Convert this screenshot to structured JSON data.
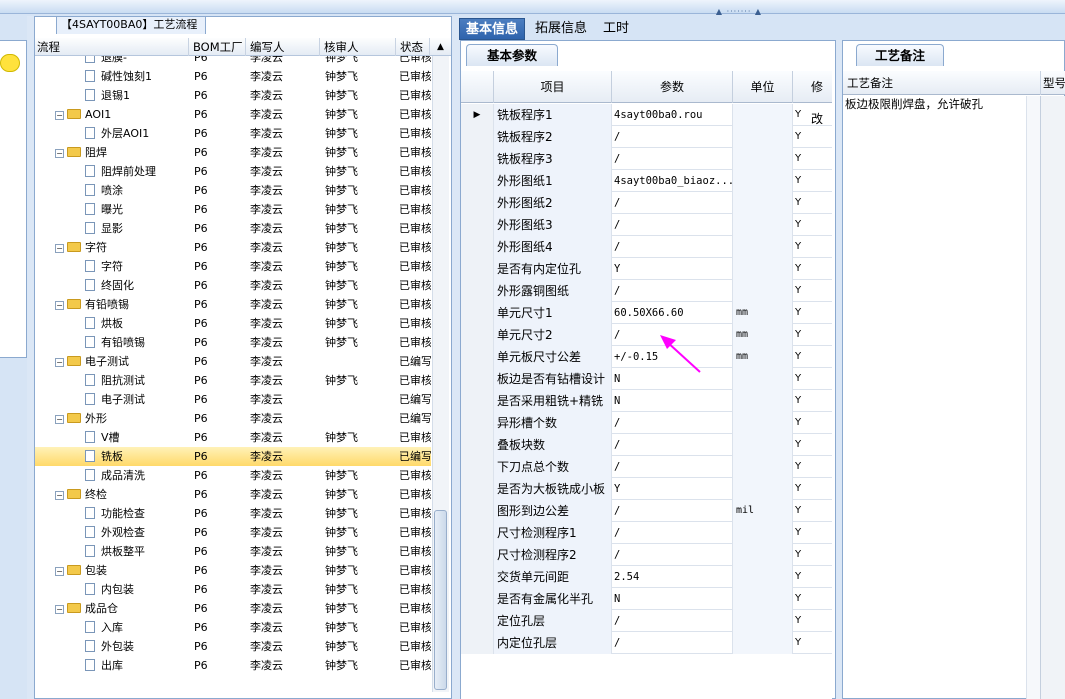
{
  "tree_panel": {
    "title": "【4SAYT00BA0】工艺流程",
    "columns": [
      "流程",
      "BOM工厂",
      "编写人",
      "核审人",
      "状态"
    ],
    "rows": [
      {
        "kind": "leaf",
        "name": "退膜-",
        "bom": "P6",
        "writer": "李凌云",
        "reviewer": "钟梦飞",
        "status": "已审核"
      },
      {
        "kind": "leaf",
        "name": "碱性蚀刻1",
        "bom": "P6",
        "writer": "李凌云",
        "reviewer": "钟梦飞",
        "status": "已审核"
      },
      {
        "kind": "leaf",
        "name": "退锡1",
        "bom": "P6",
        "writer": "李凌云",
        "reviewer": "钟梦飞",
        "status": "已审核"
      },
      {
        "kind": "folder",
        "name": "AOI1",
        "bom": "P6",
        "writer": "李凌云",
        "reviewer": "钟梦飞",
        "status": "已审核"
      },
      {
        "kind": "leaf",
        "name": "外层AOI1",
        "bom": "P6",
        "writer": "李凌云",
        "reviewer": "钟梦飞",
        "status": "已审核"
      },
      {
        "kind": "folder",
        "name": "阻焊",
        "bom": "P6",
        "writer": "李凌云",
        "reviewer": "钟梦飞",
        "status": "已审核"
      },
      {
        "kind": "leaf",
        "name": "阻焊前处理",
        "bom": "P6",
        "writer": "李凌云",
        "reviewer": "钟梦飞",
        "status": "已审核"
      },
      {
        "kind": "leaf",
        "name": "喷涂",
        "bom": "P6",
        "writer": "李凌云",
        "reviewer": "钟梦飞",
        "status": "已审核"
      },
      {
        "kind": "leaf",
        "name": "曝光",
        "bom": "P6",
        "writer": "李凌云",
        "reviewer": "钟梦飞",
        "status": "已审核"
      },
      {
        "kind": "leaf",
        "name": "显影",
        "bom": "P6",
        "writer": "李凌云",
        "reviewer": "钟梦飞",
        "status": "已审核"
      },
      {
        "kind": "folder",
        "name": "字符",
        "bom": "P6",
        "writer": "李凌云",
        "reviewer": "钟梦飞",
        "status": "已审核"
      },
      {
        "kind": "leaf",
        "name": "字符",
        "bom": "P6",
        "writer": "李凌云",
        "reviewer": "钟梦飞",
        "status": "已审核"
      },
      {
        "kind": "leaf",
        "name": "终固化",
        "bom": "P6",
        "writer": "李凌云",
        "reviewer": "钟梦飞",
        "status": "已审核"
      },
      {
        "kind": "folder",
        "name": "有铅喷锡",
        "bom": "P6",
        "writer": "李凌云",
        "reviewer": "钟梦飞",
        "status": "已审核"
      },
      {
        "kind": "leaf",
        "name": "烘板",
        "bom": "P6",
        "writer": "李凌云",
        "reviewer": "钟梦飞",
        "status": "已审核"
      },
      {
        "kind": "leaf",
        "name": "有铅喷锡",
        "bom": "P6",
        "writer": "李凌云",
        "reviewer": "钟梦飞",
        "status": "已审核"
      },
      {
        "kind": "folder",
        "name": "电子测试",
        "bom": "P6",
        "writer": "李凌云",
        "reviewer": "",
        "status": "已编写"
      },
      {
        "kind": "leaf",
        "name": "阻抗测试",
        "bom": "P6",
        "writer": "李凌云",
        "reviewer": "钟梦飞",
        "status": "已审核"
      },
      {
        "kind": "leaf",
        "name": "电子测试",
        "bom": "P6",
        "writer": "李凌云",
        "reviewer": "",
        "status": "已编写"
      },
      {
        "kind": "folder",
        "name": "外形",
        "bom": "P6",
        "writer": "李凌云",
        "reviewer": "",
        "status": "已编写"
      },
      {
        "kind": "leaf",
        "name": "V槽",
        "bom": "P6",
        "writer": "李凌云",
        "reviewer": "钟梦飞",
        "status": "已审核"
      },
      {
        "kind": "leaf",
        "name": "铣板",
        "bom": "P6",
        "writer": "李凌云",
        "reviewer": "",
        "status": "已编写",
        "selected": true
      },
      {
        "kind": "leaf",
        "name": "成品清洗",
        "bom": "P6",
        "writer": "李凌云",
        "reviewer": "钟梦飞",
        "status": "已审核"
      },
      {
        "kind": "folder",
        "name": "终检",
        "bom": "P6",
        "writer": "李凌云",
        "reviewer": "钟梦飞",
        "status": "已审核"
      },
      {
        "kind": "leaf",
        "name": "功能检查",
        "bom": "P6",
        "writer": "李凌云",
        "reviewer": "钟梦飞",
        "status": "已审核"
      },
      {
        "kind": "leaf",
        "name": "外观检查",
        "bom": "P6",
        "writer": "李凌云",
        "reviewer": "钟梦飞",
        "status": "已审核"
      },
      {
        "kind": "leaf",
        "name": "烘板整平",
        "bom": "P6",
        "writer": "李凌云",
        "reviewer": "钟梦飞",
        "status": "已审核"
      },
      {
        "kind": "folder",
        "name": "包装",
        "bom": "P6",
        "writer": "李凌云",
        "reviewer": "钟梦飞",
        "status": "已审核"
      },
      {
        "kind": "leaf",
        "name": "内包装",
        "bom": "P6",
        "writer": "李凌云",
        "reviewer": "钟梦飞",
        "status": "已审核"
      },
      {
        "kind": "folder",
        "name": "成品仓",
        "bom": "P6",
        "writer": "李凌云",
        "reviewer": "钟梦飞",
        "status": "已审核"
      },
      {
        "kind": "leaf",
        "name": "入库",
        "bom": "P6",
        "writer": "李凌云",
        "reviewer": "钟梦飞",
        "status": "已审核"
      },
      {
        "kind": "leaf",
        "name": "外包装",
        "bom": "P6",
        "writer": "李凌云",
        "reviewer": "钟梦飞",
        "status": "已审核"
      },
      {
        "kind": "leaf",
        "name": "出库",
        "bom": "P6",
        "writer": "李凌云",
        "reviewer": "钟梦飞",
        "status": "已审核"
      }
    ]
  },
  "main_tabs": [
    "基本信息",
    "拓展信息",
    "工时"
  ],
  "subtab": "基本参数",
  "grid": {
    "columns": [
      "项目",
      "参数",
      "单位",
      "修改"
    ],
    "rows": [
      {
        "item": "铣板程序1",
        "value": "4sayt00ba0.rou",
        "unit": "",
        "mod": "Y",
        "current": true
      },
      {
        "item": "铣板程序2",
        "value": "/",
        "unit": "",
        "mod": "Y"
      },
      {
        "item": "铣板程序3",
        "value": "/",
        "unit": "",
        "mod": "Y"
      },
      {
        "item": "外形图纸1",
        "value": "4sayt00ba0_biaoz...",
        "unit": "",
        "mod": "Y"
      },
      {
        "item": "外形图纸2",
        "value": "/",
        "unit": "",
        "mod": "Y"
      },
      {
        "item": "外形图纸3",
        "value": "/",
        "unit": "",
        "mod": "Y"
      },
      {
        "item": "外形图纸4",
        "value": "/",
        "unit": "",
        "mod": "Y"
      },
      {
        "item": "是否有内定位孔",
        "value": "Y",
        "unit": "",
        "mod": "Y"
      },
      {
        "item": "外形露铜图纸",
        "value": "/",
        "unit": "",
        "mod": "Y"
      },
      {
        "item": "单元尺寸1",
        "value": "60.50X66.60",
        "unit": "mm",
        "mod": "Y"
      },
      {
        "item": "单元尺寸2",
        "value": "/",
        "unit": "mm",
        "mod": "Y"
      },
      {
        "item": "单元板尺寸公差",
        "value": "+/-0.15",
        "unit": "mm",
        "mod": "Y"
      },
      {
        "item": "板边是否有钻槽设计",
        "value": "N",
        "unit": "",
        "mod": "Y"
      },
      {
        "item": "是否采用粗铣+精铣",
        "value": "N",
        "unit": "",
        "mod": "Y"
      },
      {
        "item": "异形槽个数",
        "value": "/",
        "unit": "",
        "mod": "Y"
      },
      {
        "item": "叠板块数",
        "value": "/",
        "unit": "",
        "mod": "Y"
      },
      {
        "item": "下刀点总个数",
        "value": "/",
        "unit": "",
        "mod": "Y"
      },
      {
        "item": "是否为大板铣成小板",
        "value": "Y",
        "unit": "",
        "mod": "Y"
      },
      {
        "item": "图形到边公差",
        "value": "/",
        "unit": "mil",
        "mod": "Y"
      },
      {
        "item": "尺寸检测程序1",
        "value": "/",
        "unit": "",
        "mod": "Y"
      },
      {
        "item": "尺寸检测程序2",
        "value": "/",
        "unit": "",
        "mod": "Y"
      },
      {
        "item": "交货单元间距",
        "value": "2.54",
        "unit": "",
        "mod": "Y"
      },
      {
        "item": "是否有金属化半孔",
        "value": "N",
        "unit": "",
        "mod": "Y"
      },
      {
        "item": "定位孔层",
        "value": "/",
        "unit": "",
        "mod": "Y"
      },
      {
        "item": "内定位孔层",
        "value": "/",
        "unit": "",
        "mod": "Y"
      }
    ]
  },
  "notes_panel": {
    "tab": "工艺备注",
    "col1": "工艺备注",
    "col2": "型号",
    "text": "板边极限削焊盘，允许破孔"
  },
  "annotation": {
    "color": "#ff00ff",
    "icon": "arrow-annotation"
  }
}
